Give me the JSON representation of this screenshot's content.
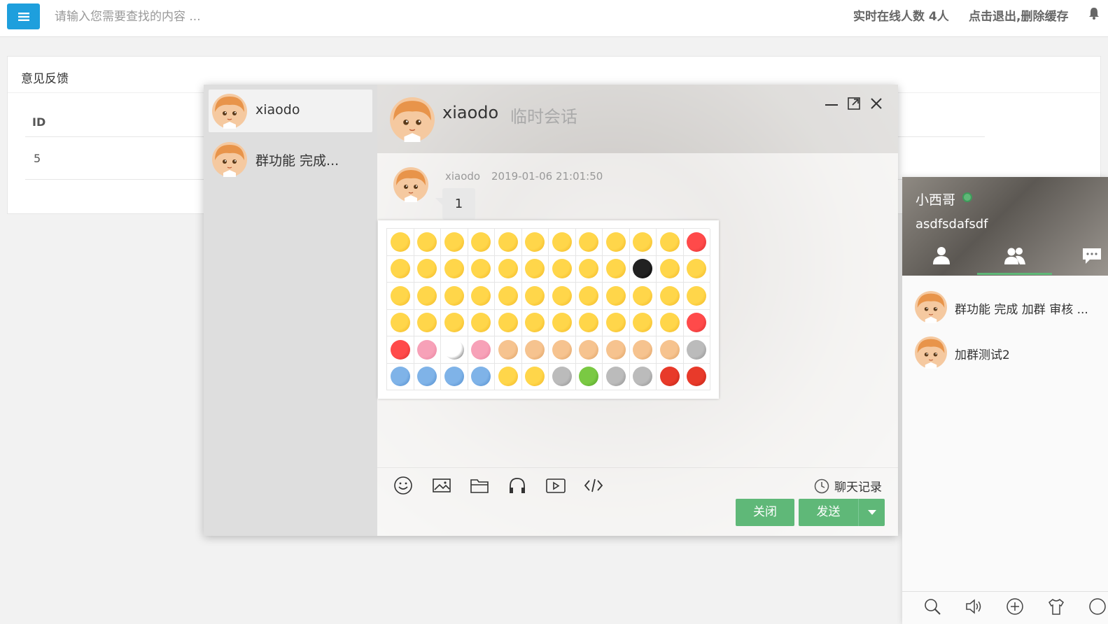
{
  "topbar": {
    "search_placeholder": "请输入您需要查找的内容 ...",
    "online_text": "实时在线人数 4人",
    "logout_text": "点击退出,删除缓存",
    "accent": "#1e9fdd"
  },
  "feedback": {
    "title": "意见反馈",
    "columns": [
      "ID"
    ],
    "rows": [
      [
        "5"
      ]
    ]
  },
  "chat": {
    "list": [
      {
        "name": "xiaodo",
        "active": true
      },
      {
        "name": "群功能 完成..."
      }
    ],
    "header": {
      "name": "xiaodo",
      "subtitle": "临时会话"
    },
    "message": {
      "user": "xiaodo",
      "time": "2019-01-06 21:01:50",
      "text": "1"
    },
    "history_label": "聊天记录",
    "close_label": "关闭",
    "send_label": "发送",
    "button_color": "#5fb878"
  },
  "emoji_panel": {
    "rows": 6,
    "cols": 12,
    "icons": [
      "smile",
      "grin",
      "laugh",
      "happy",
      "surprised-eyes",
      "cry-laugh",
      "shock",
      "smirk",
      "tongue",
      "silent",
      "sad",
      "heart-face",
      "crying",
      "yawn",
      "shy",
      "wet",
      "blush",
      "dizzy",
      "angry",
      "glare",
      "bored",
      "black-face",
      "frown",
      "astonished",
      "sweat",
      "hug",
      "mad",
      "sick",
      "wink",
      "think",
      "confused",
      "drool",
      "sleepy",
      "sleep",
      "money",
      "worried",
      "cool",
      "love-eyes",
      "annoyed",
      "hush",
      "kiss",
      "pout",
      "scream",
      "snicker",
      "grin-wide",
      "confident",
      "text-emoji",
      "heart",
      "broken-heart",
      "pig",
      "panda",
      "rabbit",
      "ok-hand",
      "victory",
      "thumbs-up",
      "one-finger",
      "fist",
      "clap",
      "thumbs-down",
      "bear",
      "stamp",
      "clock",
      "cloud",
      "give-stamp",
      "people",
      "arrow-down",
      "robot",
      "gift",
      "clock-face",
      "microphone",
      "candle",
      "cake"
    ]
  },
  "contacts": {
    "me": {
      "name": "小西哥",
      "signature": "asdfsdafsdf",
      "status_color": "#5fb878"
    },
    "groups": [
      {
        "name": "群功能 完成 加群 审核 ..."
      },
      {
        "name": "加群测试2"
      }
    ]
  }
}
